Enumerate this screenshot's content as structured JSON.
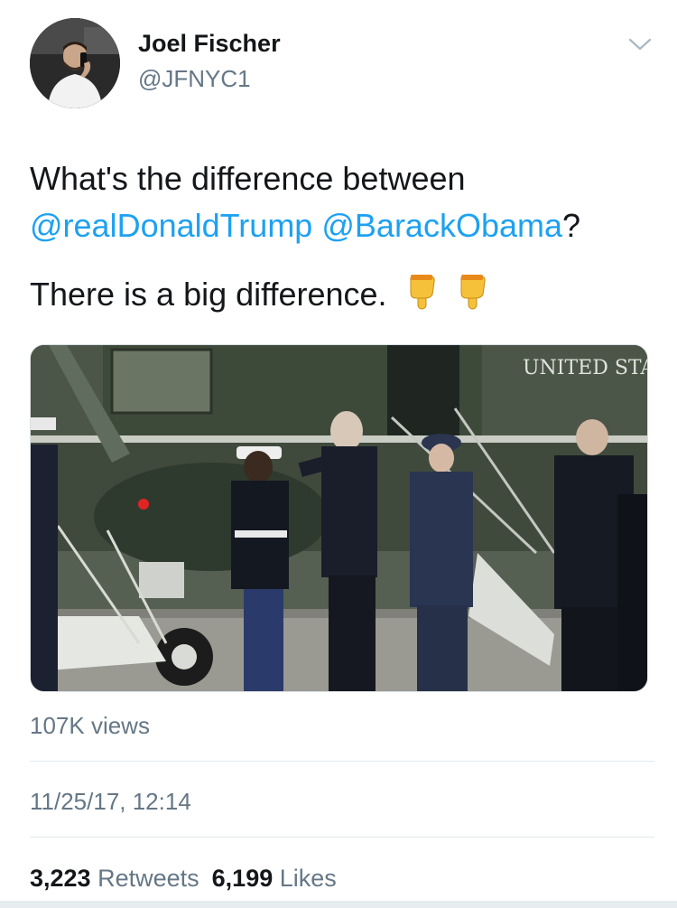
{
  "user": {
    "display_name": "Joel Fischer",
    "handle": "@JFNYC1"
  },
  "tweet": {
    "text_line1": "What's the difference between",
    "mention1": "@realDonaldTrump",
    "mention2": "@BarackObama",
    "question_mark": "?",
    "text_line3": "There is a big difference.",
    "emoji": [
      "pointing-down-emoji",
      "pointing-down-emoji"
    ]
  },
  "media": {
    "overlay_text": "UNITED STA"
  },
  "views": "107K views",
  "timestamp": "11/25/17, 12:14",
  "stats": {
    "retweets_count": "3,223",
    "retweets_label": "Retweets",
    "likes_count": "6,199",
    "likes_label": "Likes"
  },
  "colors": {
    "link": "#1da1f2",
    "secondary": "#657786",
    "primary": "#14171a"
  }
}
